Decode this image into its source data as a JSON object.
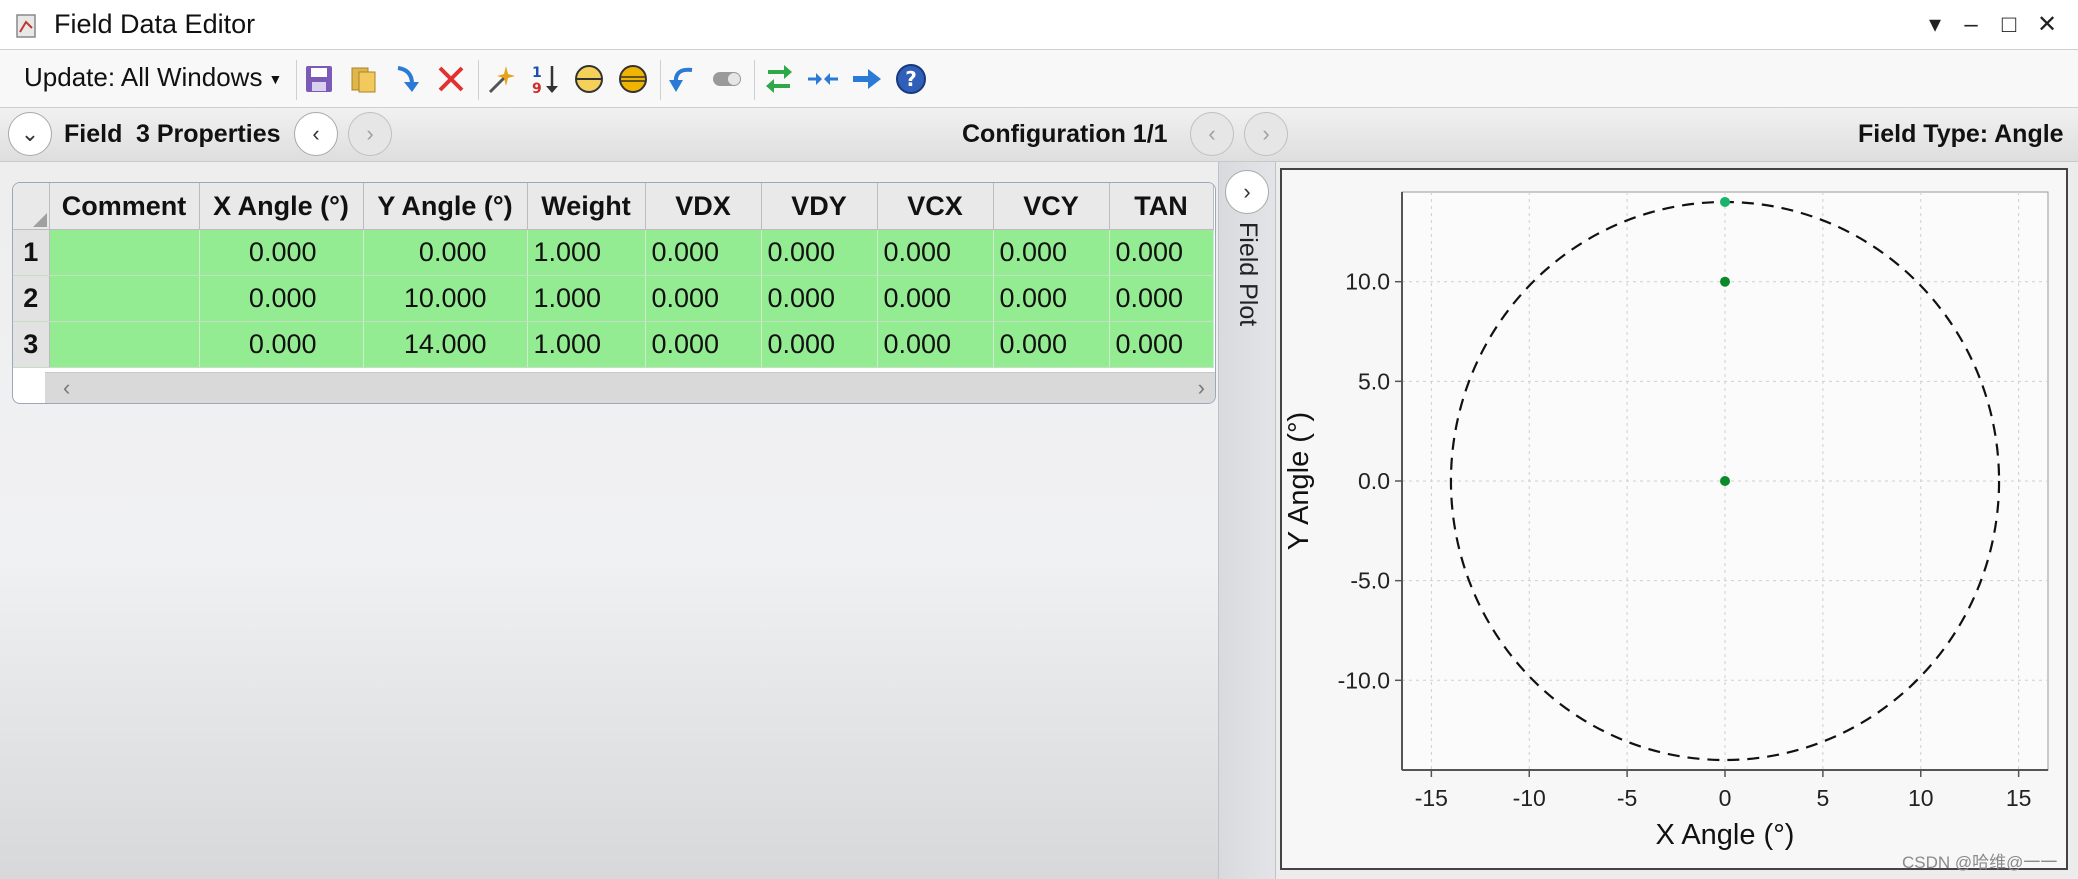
{
  "window": {
    "title": "Field Data Editor",
    "controls": [
      "▾",
      "–",
      "□",
      "✕"
    ]
  },
  "toolbar": {
    "update_label": "Update: All Windows",
    "icons": [
      "save-icon",
      "open-icon",
      "insert-icon",
      "delete-icon",
      "wizard-icon",
      "sort-icon",
      "vignetting-icon",
      "vignetting-set-icon",
      "undo-icon",
      "toggle-icon",
      "swap-icon",
      "compress-icon",
      "arrow-right-icon",
      "help-icon"
    ]
  },
  "properties_bar": {
    "field_label": "Field",
    "properties_label": "3 Properties",
    "configuration_label": "Configuration 1/1",
    "field_type_label": "Field Type: Angle"
  },
  "grid": {
    "columns": [
      "Comment",
      "X Angle (°)",
      "Y Angle (°)",
      "Weight",
      "VDX",
      "VDY",
      "VCX",
      "VCY",
      "TAN"
    ],
    "rows": [
      {
        "index": "1",
        "comment": "",
        "x": "0.000",
        "y": "0.000",
        "weight": "1.000",
        "vdx": "0.000",
        "vdy": "0.000",
        "vcx": "0.000",
        "vcy": "0.000",
        "tan": "0.000"
      },
      {
        "index": "2",
        "comment": "",
        "x": "0.000",
        "y": "10.000",
        "weight": "1.000",
        "vdx": "0.000",
        "vdy": "0.000",
        "vcx": "0.000",
        "vcy": "0.000",
        "tan": "0.000"
      },
      {
        "index": "3",
        "comment": "",
        "x": "0.000",
        "y": "14.000",
        "weight": "1.000",
        "vdx": "0.000",
        "vdy": "0.000",
        "vcx": "0.000",
        "vcy": "0.000",
        "tan": "0.000"
      }
    ],
    "row_color": "#94ec92"
  },
  "side_panel": {
    "label": "Field Plot"
  },
  "chart_data": {
    "type": "scatter",
    "xlabel": "X Angle (°)",
    "ylabel": "Y Angle (°)",
    "xlim": [
      -16.5,
      16.5
    ],
    "ylim": [
      -14.5,
      14.5
    ],
    "xticks": [
      -15,
      -10,
      -5,
      0,
      5,
      10,
      15
    ],
    "xtick_labels": [
      "-15",
      "-10",
      "-5",
      "0",
      "5",
      "10",
      "15"
    ],
    "yticks": [
      10,
      5,
      0,
      -5,
      -10
    ],
    "ytick_labels": [
      "10.0",
      "5.0",
      "0.0",
      "-5.0",
      "-10.0"
    ],
    "points": [
      {
        "x": 0,
        "y": 0
      },
      {
        "x": 0,
        "y": 10
      },
      {
        "x": 0,
        "y": 14
      }
    ],
    "boundary_circle_radius": 14,
    "grid": true,
    "point_color": "#0a8a2a",
    "last_point_color": "#19b36a"
  },
  "watermark": "CSDN @哈维@一一"
}
